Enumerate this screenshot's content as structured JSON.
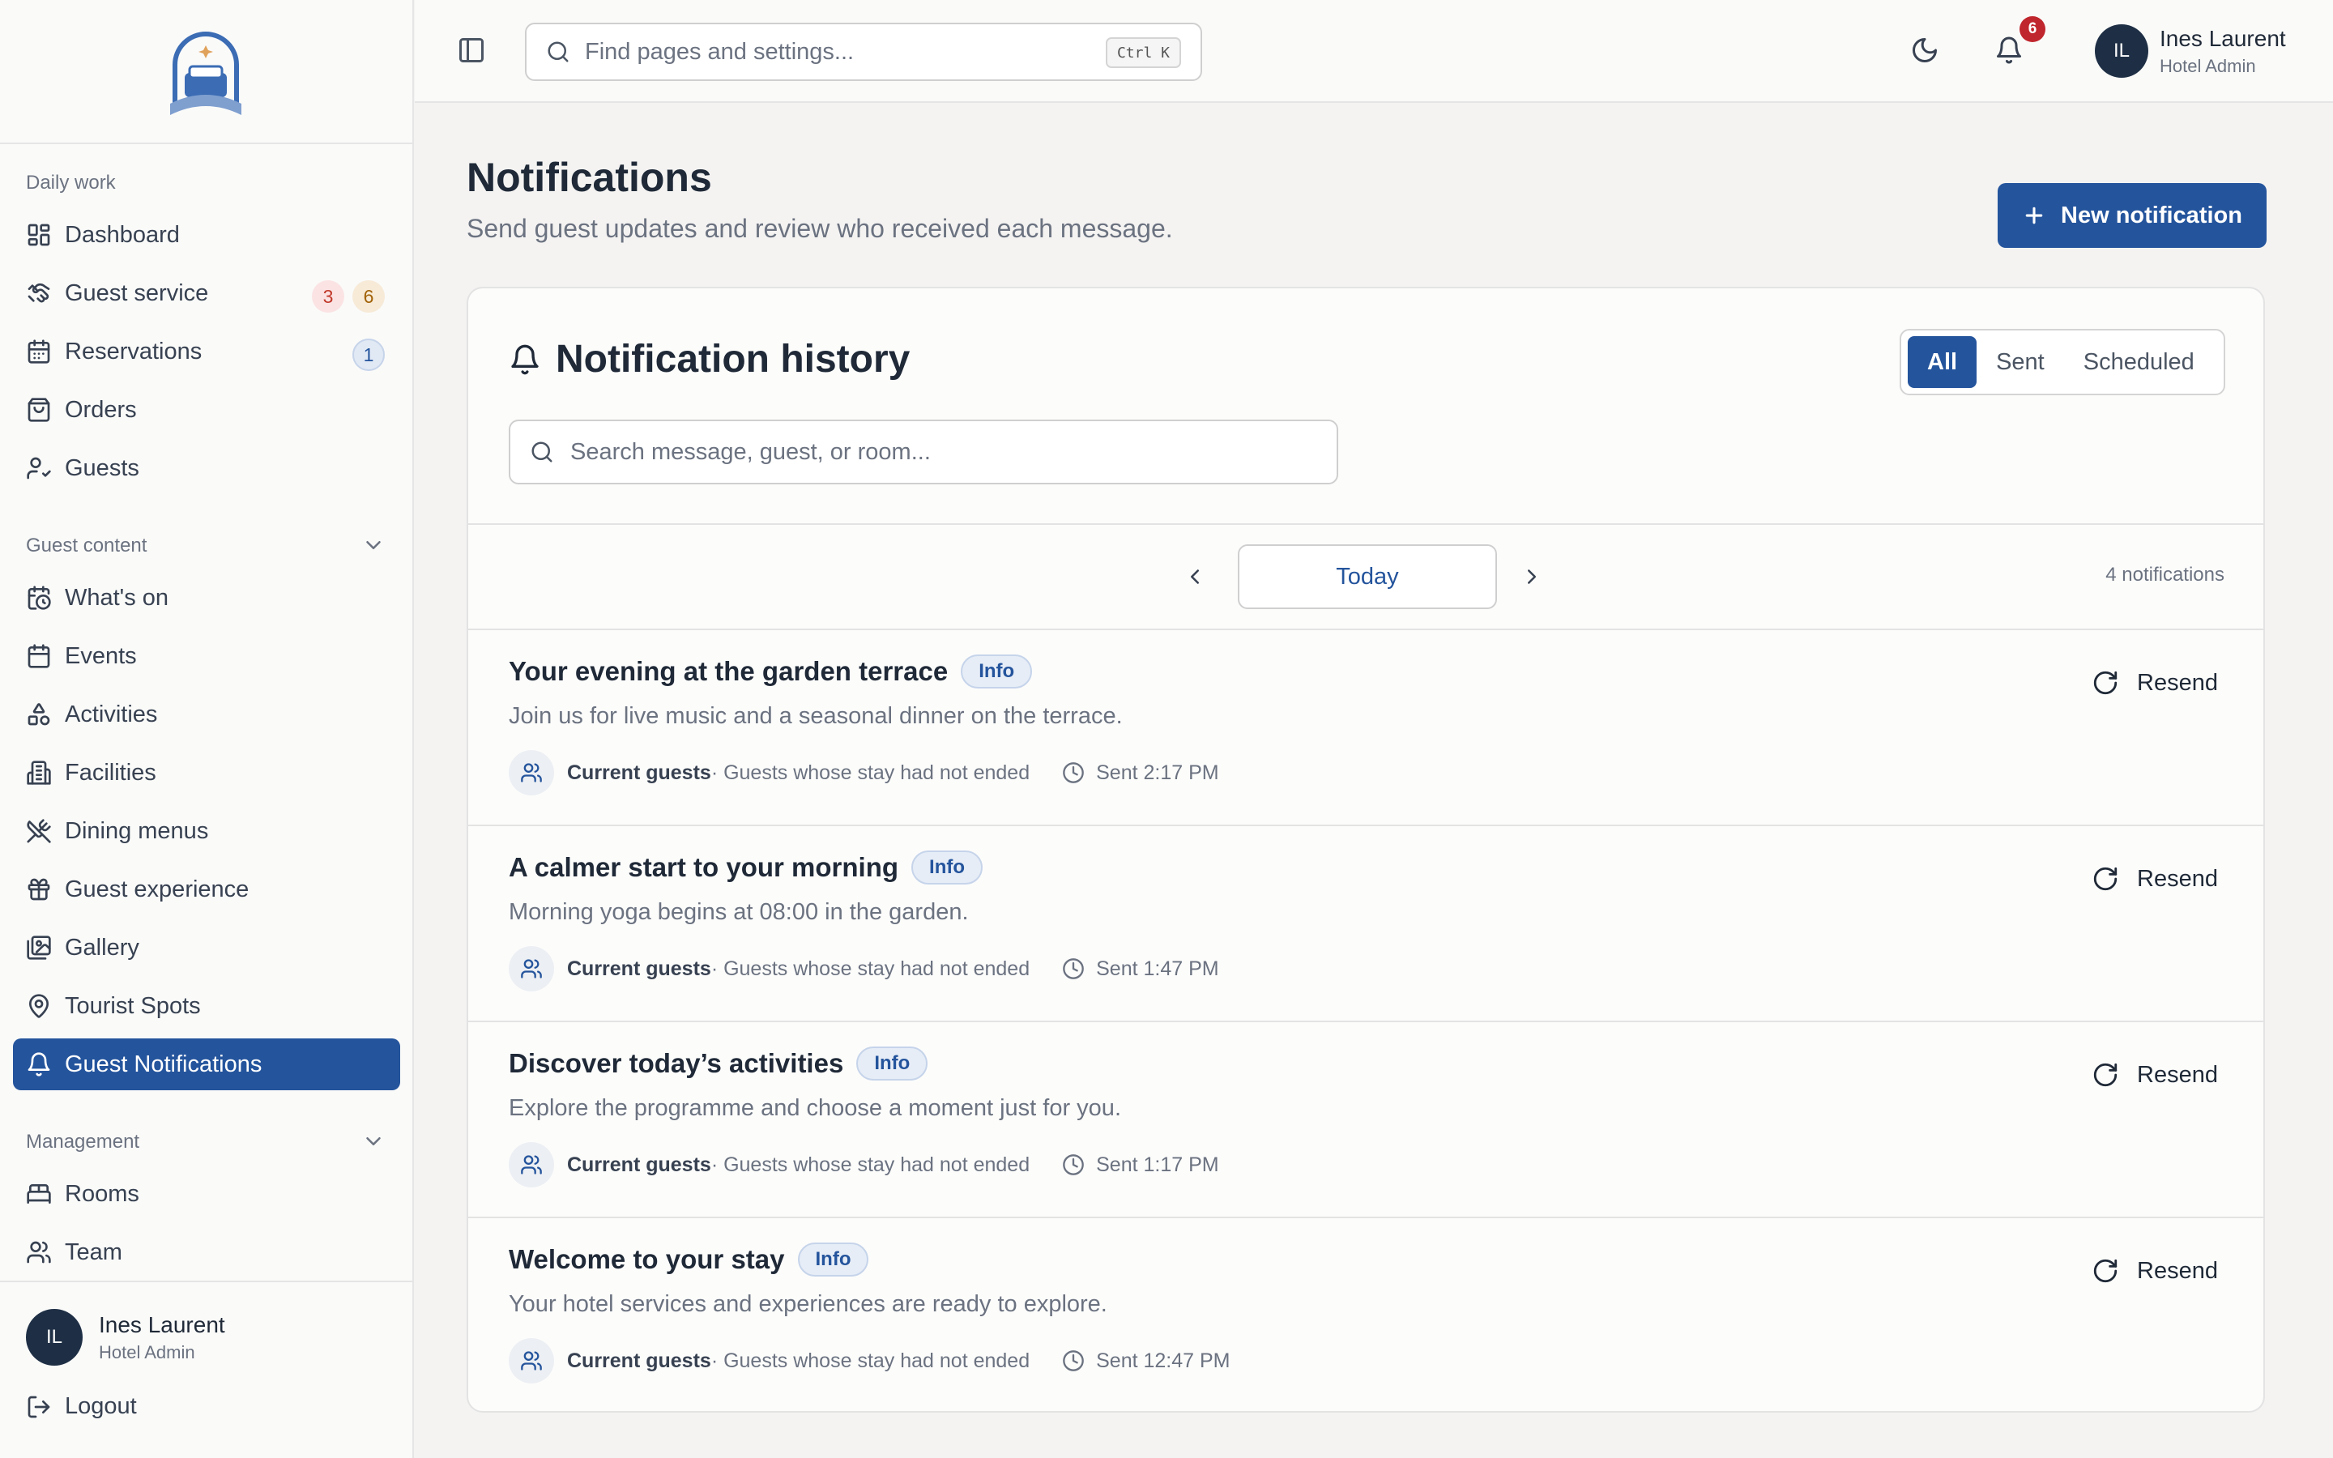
{
  "sidebar": {
    "sections": {
      "daily": "Daily work",
      "content": "Guest content",
      "management": "Management"
    },
    "items": [
      {
        "label": "Dashboard",
        "icon": "dashboard-icon"
      },
      {
        "label": "Guest service",
        "icon": "handshake-icon",
        "badges": [
          "3",
          "6"
        ]
      },
      {
        "label": "Reservations",
        "icon": "calendar-icon",
        "badges": [
          "1"
        ]
      },
      {
        "label": "Orders",
        "icon": "shopping-bag-icon"
      },
      {
        "label": "Guests",
        "icon": "user-check-icon"
      },
      {
        "label": "What's on",
        "icon": "calendar-clock-icon"
      },
      {
        "label": "Events",
        "icon": "calendar-icon"
      },
      {
        "label": "Activities",
        "icon": "shapes-icon"
      },
      {
        "label": "Facilities",
        "icon": "building-icon"
      },
      {
        "label": "Dining menus",
        "icon": "utensils-icon"
      },
      {
        "label": "Guest experience",
        "icon": "gift-icon"
      },
      {
        "label": "Gallery",
        "icon": "images-icon"
      },
      {
        "label": "Tourist Spots",
        "icon": "map-pin-icon"
      },
      {
        "label": "Guest Notifications",
        "icon": "bell-icon",
        "active": true
      },
      {
        "label": "Rooms",
        "icon": "bed-icon"
      },
      {
        "label": "Team",
        "icon": "users-icon"
      }
    ],
    "user": {
      "initials": "IL",
      "name": "Ines Laurent",
      "role": "Hotel Admin"
    },
    "logout": "Logout"
  },
  "topbar": {
    "search_placeholder": "Find pages and settings...",
    "shortcut": "Ctrl K",
    "notification_count": "6",
    "user": {
      "initials": "IL",
      "name": "Ines Laurent",
      "role": "Hotel Admin"
    }
  },
  "page": {
    "title": "Notifications",
    "subtitle": "Send guest updates and review who received each message.",
    "new_button": "New notification"
  },
  "history": {
    "title": "Notification history",
    "filters": [
      "All",
      "Sent",
      "Scheduled"
    ],
    "active_filter": "All",
    "search_placeholder": "Search message, guest, or room...",
    "date_label": "Today",
    "count": "4 notifications",
    "resend_label": "Resend",
    "items": [
      {
        "title": "Your evening at the garden terrace",
        "tag": "Info",
        "body": "Join us for live music and a seasonal dinner on the terrace.",
        "audience": "Current guests",
        "audience_desc": " · Guests whose stay had not ended",
        "sent": "Sent 2:17 PM"
      },
      {
        "title": "A calmer start to your morning",
        "tag": "Info",
        "body": "Morning yoga begins at 08:00 in the garden.",
        "audience": "Current guests",
        "audience_desc": " · Guests whose stay had not ended",
        "sent": "Sent 1:47 PM"
      },
      {
        "title": "Discover today’s activities",
        "tag": "Info",
        "body": "Explore the programme and choose a moment just for you.",
        "audience": "Current guests",
        "audience_desc": " · Guests whose stay had not ended",
        "sent": "Sent 1:17 PM"
      },
      {
        "title": "Welcome to your stay",
        "tag": "Info",
        "body": "Your hotel services and experiences are ready to explore.",
        "audience": "Current guests",
        "audience_desc": " · Guests whose stay had not ended",
        "sent": "Sent 12:47 PM"
      }
    ]
  },
  "colors": {
    "primary": "#24549c",
    "danger": "#c0262d",
    "sidebar_bg": "#fafaf9",
    "page_bg": "#f4f3f2"
  }
}
